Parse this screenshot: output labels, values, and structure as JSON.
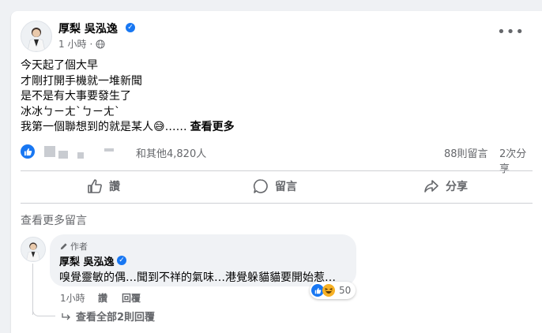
{
  "post": {
    "author": "厚梨 吳泓逸",
    "time": "1 小時",
    "lines": [
      "今天起了個大早",
      "才剛打開手機就一堆新聞",
      "是不是有大事要發生了",
      "冰冰ㄅㄧㄤˋㄅㄧㄤˋ",
      "我第一個聯想到的就是某人😅……"
    ],
    "see_more": "查看更多"
  },
  "stats": {
    "reactors": "和其他4,820人",
    "comments": "88則留言",
    "shares": "2次分享"
  },
  "actions": {
    "like": "讚",
    "comment": "留言",
    "share": "分享"
  },
  "comments_section": {
    "view_more": "查看更多留言",
    "comment": {
      "badge": "作者",
      "author": "厚梨 吳泓逸",
      "text": "嗅覺靈敏的偶…聞到不祥的氣味…港覺躲貓貓要開始惹…",
      "reaction_count": "50",
      "time": "1小時",
      "like": "讚",
      "reply": "回覆",
      "view_replies": "查看全部2則回覆"
    }
  },
  "colors": {
    "accent": "#1877f2",
    "secondary_text": "#65676b",
    "background": "#eff1f4"
  }
}
